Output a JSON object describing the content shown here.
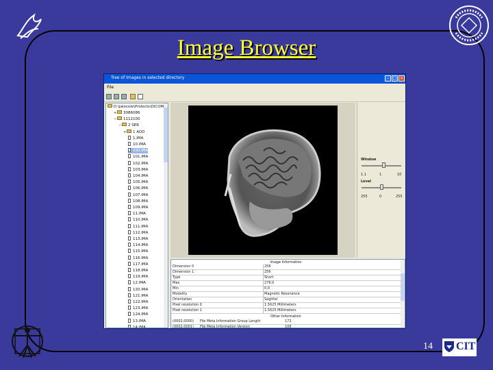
{
  "slide": {
    "title": "Image Browser",
    "page_number": "14",
    "logos": [
      "hhs-eagle-logo",
      "nih-seal-logo",
      "vitruvian-man-logo"
    ],
    "cit_logo_text": "CIT"
  },
  "window": {
    "title": "Tree of images in selected directory",
    "menu": [
      "File"
    ],
    "toolbar_icons": [
      "open-icon",
      "grid-icon",
      "save-icon",
      "folder-icon",
      "copy-icon"
    ]
  },
  "tree": {
    "root": "D:\\Jalocole\\Prolects\\DICOMs",
    "nodes": [
      {
        "label": "3086086",
        "level": 1,
        "expander": "+",
        "type": "folder"
      },
      {
        "label": "1112100",
        "level": 1,
        "expander": "−",
        "type": "folder"
      },
      {
        "label": "2 SER",
        "level": 2,
        "expander": "−",
        "type": "folder"
      },
      {
        "label": "1 ADD",
        "level": 3,
        "expander": "+",
        "type": "folder"
      },
      {
        "label": "1.IMA",
        "level": 4,
        "type": "file"
      },
      {
        "label": "10.IMA",
        "level": 4,
        "type": "file"
      },
      {
        "label": "100.IMA",
        "level": 4,
        "type": "file",
        "selected": true
      },
      {
        "label": "101.IMA",
        "level": 4,
        "type": "file"
      },
      {
        "label": "102.IMA",
        "level": 4,
        "type": "file"
      },
      {
        "label": "103.IMA",
        "level": 4,
        "type": "file"
      },
      {
        "label": "104.IMA",
        "level": 4,
        "type": "file"
      },
      {
        "label": "105.IMA",
        "level": 4,
        "type": "file"
      },
      {
        "label": "106.IMA",
        "level": 4,
        "type": "file"
      },
      {
        "label": "107.IMA",
        "level": 4,
        "type": "file"
      },
      {
        "label": "108.IMA",
        "level": 4,
        "type": "file"
      },
      {
        "label": "109.IMA",
        "level": 4,
        "type": "file"
      },
      {
        "label": "11.IMA",
        "level": 4,
        "type": "file"
      },
      {
        "label": "110.IMA",
        "level": 4,
        "type": "file"
      },
      {
        "label": "111.IMA",
        "level": 4,
        "type": "file"
      },
      {
        "label": "112.IMA",
        "level": 4,
        "type": "file"
      },
      {
        "label": "113.IMA",
        "level": 4,
        "type": "file"
      },
      {
        "label": "114.IMA",
        "level": 4,
        "type": "file"
      },
      {
        "label": "115.IMA",
        "level": 4,
        "type": "file"
      },
      {
        "label": "116.IMA",
        "level": 4,
        "type": "file"
      },
      {
        "label": "117.IMA",
        "level": 4,
        "type": "file"
      },
      {
        "label": "118.IMA",
        "level": 4,
        "type": "file"
      },
      {
        "label": "119.IMA",
        "level": 4,
        "type": "file"
      },
      {
        "label": "12.IMA",
        "level": 4,
        "type": "file"
      },
      {
        "label": "120.IMA",
        "level": 4,
        "type": "file"
      },
      {
        "label": "121.IMA",
        "level": 4,
        "type": "file"
      },
      {
        "label": "122.IMA",
        "level": 4,
        "type": "file"
      },
      {
        "label": "123.IMA",
        "level": 4,
        "type": "file"
      },
      {
        "label": "124.IMA",
        "level": 4,
        "type": "file"
      },
      {
        "label": "13.IMA",
        "level": 4,
        "type": "file"
      },
      {
        "label": "14.IMA",
        "level": 4,
        "type": "file"
      }
    ]
  },
  "controls": {
    "window_label": "Window",
    "window_values": [
      "1.1",
      "1",
      "10"
    ],
    "window_level": 0.55,
    "level_label": "Level",
    "level_values": [
      "255",
      "0",
      "255"
    ],
    "level_level": 0.5
  },
  "image_info": {
    "header": "Image Information",
    "rows": [
      [
        "Dimension 0",
        "256"
      ],
      [
        "Dimension 1",
        "256"
      ],
      [
        "Type",
        "Short"
      ],
      [
        "Max",
        "276.0"
      ],
      [
        "Min",
        "0.0"
      ],
      [
        "Modality",
        "Magnetic Resonance"
      ],
      [
        "Orientation",
        "Sagittal"
      ],
      [
        "Pixel resolution 0",
        "1.5625 Millimeters"
      ],
      [
        "Pixel resolution 1",
        "1.5625 Millimeters"
      ]
    ]
  },
  "other_info": {
    "header": "Other Information",
    "rows": [
      [
        "(0002,0000)",
        "File Meta Information Group Length",
        "172"
      ],
      [
        "(0002,0001)",
        "File Meta Information Version",
        "106"
      ]
    ]
  }
}
